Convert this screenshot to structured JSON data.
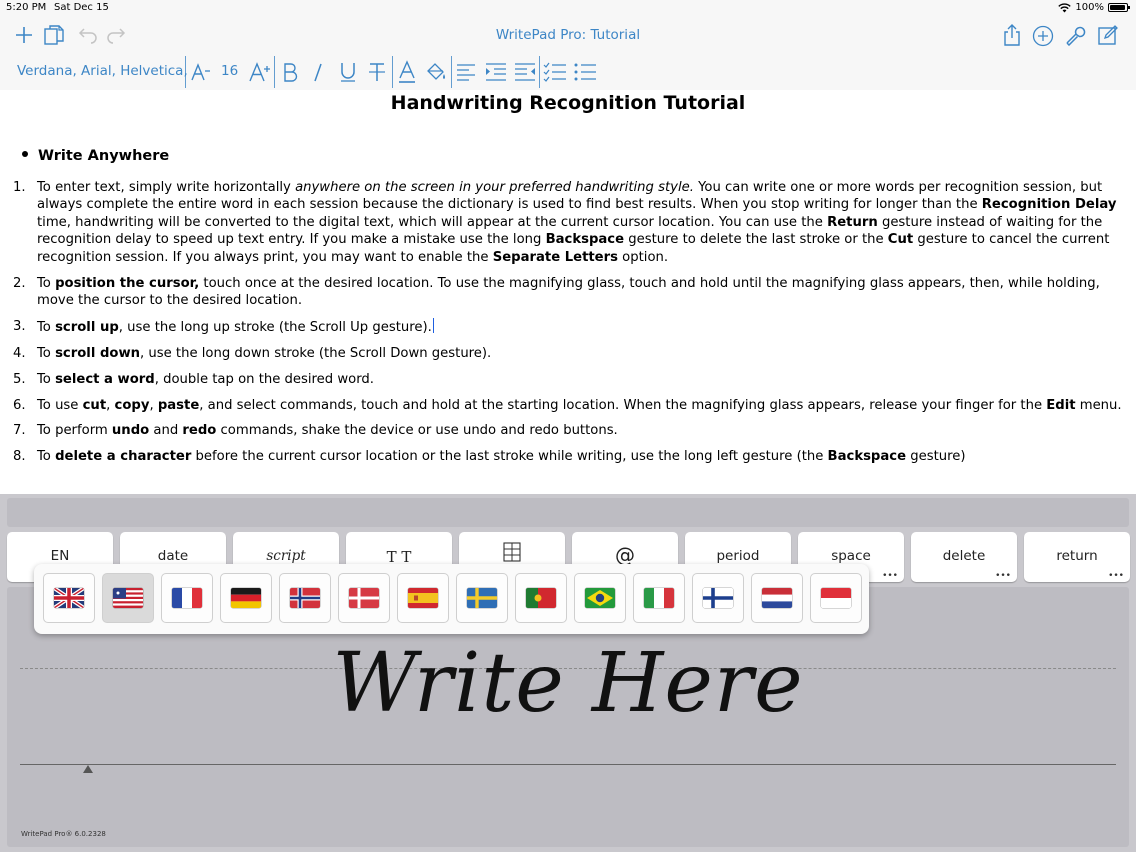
{
  "status": {
    "time": "5:20 PM",
    "date": "Sat Dec 15",
    "battery": "100%"
  },
  "nav": {
    "title": "WritePad Pro: Tutorial"
  },
  "format": {
    "font_name": "Verdana, Arial, Helvetica,",
    "font_size": "16"
  },
  "doc": {
    "title": "Handwriting Recognition Tutorial",
    "bullet": "Write Anywhere",
    "items": [
      {
        "num": "1.",
        "t1": "To enter text, simply write horizontally ",
        "i1": "anywhere on the screen in your preferred handwriting style.",
        "t2": " You can write one or more words per recognition session, but always complete the entire word in each session because the dictionary is used to find best results. When you stop writing for longer than the ",
        "b1": "Recognition Delay",
        "t3": " time, handwriting will be converted to the digital text, which will appear at the current cursor location. You can use the ",
        "b2": "Return",
        "t4": " gesture instead of waiting for the recognition delay to speed up text entry. If you make a mistake use the long ",
        "b3": "Backspace",
        "t5": " gesture to delete the last stroke or the ",
        "b4": "Cut",
        "t6": " gesture to cancel the current recognition session. If you always print, you may want to enable the ",
        "b5": "Separate Letters",
        "t7": " option."
      },
      {
        "num": "2.",
        "t1": "To ",
        "b1": "position the cursor,",
        "t2": " touch once at the desired location. To use the magnifying glass, touch and hold until the magnifying glass appears, then, while holding, move the cursor to the desired location."
      },
      {
        "num": "3.",
        "t1": "To ",
        "b1": "scroll up",
        "t2": ", use the long up stroke (the Scroll Up gesture)."
      },
      {
        "num": "4.",
        "t1": "To ",
        "b1": "scroll down",
        "t2": ", use the long down stroke (the Scroll Down gesture)."
      },
      {
        "num": "5.",
        "t1": "To ",
        "b1": "select a word",
        "t2": ", double tap on the desired word."
      },
      {
        "num": "6.",
        "t1": "To use ",
        "b1": "cut",
        "t2": ", ",
        "b2": "copy",
        "t3": ", ",
        "b3": "paste",
        "t4": ", and select commands, touch and hold at the starting location. When the magnifying glass appears, release your finger for the ",
        "b4": "Edit",
        "t5": " menu."
      },
      {
        "num": "7.",
        "t1": "To perform ",
        "b1": "undo",
        "t2": " and ",
        "b2": "redo",
        "t3": " commands, shake the device or use undo and redo buttons."
      },
      {
        "num": "8.",
        "t1": "To ",
        "b1": "delete a character",
        "t2": " before the current cursor location or the last stroke while writing, use the long left gesture (the ",
        "b2": "Backspace",
        "t3": " gesture)"
      }
    ]
  },
  "keyboard": {
    "keys": [
      "EN",
      "date",
      "script",
      "T T",
      "",
      "@",
      "period",
      "space",
      "delete",
      "return"
    ]
  },
  "languages": [
    "uk",
    "us",
    "fr",
    "de",
    "no",
    "dk",
    "es",
    "se",
    "pt",
    "br",
    "it",
    "fi",
    "nl",
    "id"
  ],
  "writing": {
    "prompt": "Write Here",
    "version": "WritePad Pro® 6.0.2328"
  },
  "colors": {
    "accent": "#3d86c6",
    "cursor": "#1e5fe0"
  }
}
